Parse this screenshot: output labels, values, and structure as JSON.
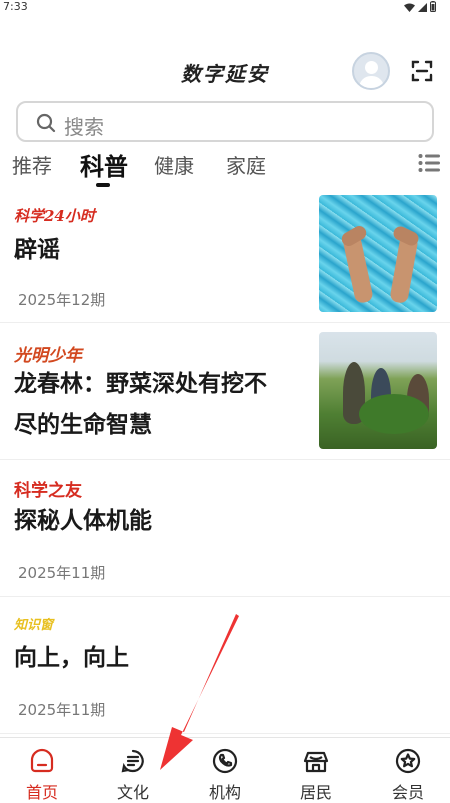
{
  "status_bar": {
    "time": "7:33"
  },
  "header": {
    "app_title": "数字延安"
  },
  "search": {
    "placeholder": "搜索"
  },
  "tabs": [
    {
      "label": "推荐",
      "active": false
    },
    {
      "label": "科普",
      "active": true
    },
    {
      "label": "健康",
      "active": false
    },
    {
      "label": "家庭",
      "active": false
    }
  ],
  "articles": [
    {
      "source": "科学24小时",
      "title": "辟谣",
      "date": "2025年12期"
    },
    {
      "source": "光明少年",
      "title_line1": "龙春林：野菜深处有挖不",
      "title_line2": "尽的生命智慧"
    },
    {
      "source": "科学之友",
      "title": "探秘人体机能",
      "date": "2025年11期"
    },
    {
      "source": "知识窗",
      "title": "向上，向上",
      "date": "2025年11期"
    }
  ],
  "bottom_nav": [
    {
      "label": "首页",
      "icon": "home-icon",
      "active": true
    },
    {
      "label": "文化",
      "icon": "culture-icon",
      "active": false
    },
    {
      "label": "机构",
      "icon": "phone-icon",
      "active": false
    },
    {
      "label": "居民",
      "icon": "residents-icon",
      "active": false
    },
    {
      "label": "会员",
      "icon": "member-icon",
      "active": false
    }
  ],
  "colors": {
    "accent_red": "#d62c20",
    "annotation_arrow": "#ee3333"
  }
}
